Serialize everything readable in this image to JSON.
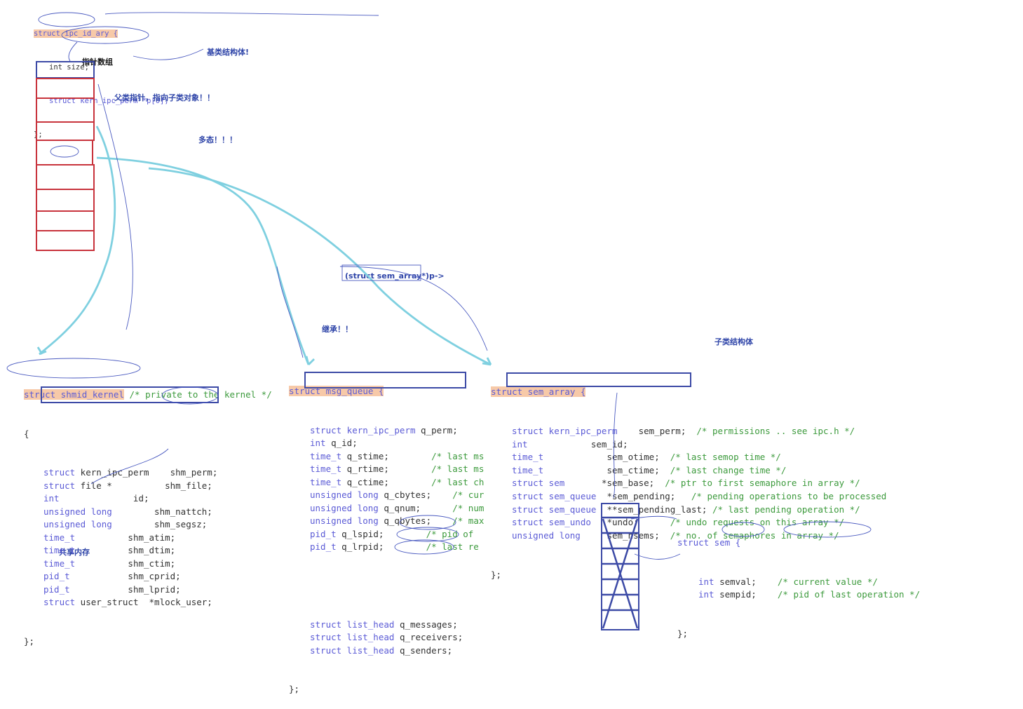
{
  "ipc_id_ary": {
    "open": "struct ipc_id_ary {",
    "l1": "int size;",
    "l2": "struct kern_ipc_perm *p[0];",
    "close": "};"
  },
  "notes": {
    "ptr_array": "指针数组",
    "base_struct": "基类结构体!",
    "parent_ptr": "父类指针，指向子类对象！！",
    "polymorph": "多态！！！",
    "cast": "(struct sem_array*)p->",
    "inherit": "继承！！",
    "child_struct": "子类结构体",
    "shared_mem": "共享内存"
  },
  "shmid_kernel": {
    "open_kw": "struct shmid_kernel",
    "open_cm": " /* private to the kernel */",
    "brace": "{",
    "lines": [
      [
        "struct",
        " kern_ipc_perm    shm_perm;"
      ],
      [
        "struct",
        " file *          shm_file;"
      ],
      [
        "int",
        "              id;"
      ],
      [
        "unsigned long",
        "        shm_nattch;"
      ],
      [
        "unsigned long",
        "        shm_segsz;"
      ],
      [
        "time_t",
        "          shm_atim;"
      ],
      [
        "time_t",
        "          shm_dtim;"
      ],
      [
        "time_t",
        "          shm_ctim;"
      ],
      [
        "pid_t",
        "           shm_cprid;"
      ],
      [
        "pid_t",
        "           shm_lprid;"
      ],
      [
        "struct",
        " user_struct  *mlock_user;"
      ]
    ],
    "close": "};"
  },
  "msg_queue": {
    "open": "struct msg_queue {",
    "lines": [
      [
        "struct kern_ipc_perm",
        " q_perm;",
        ""
      ],
      [
        "int",
        " q_id;",
        ""
      ],
      [
        "time_t",
        " q_stime;",
        "        /* last ms"
      ],
      [
        "time_t",
        " q_rtime;",
        "        /* last ms"
      ],
      [
        "time_t",
        " q_ctime;",
        "        /* last ch"
      ],
      [
        "unsigned long",
        " q_cbytes;",
        "    /* cur"
      ],
      [
        "unsigned long",
        " q_qnum;",
        "      /* num"
      ],
      [
        "unsigned long",
        " q_qbytes;",
        "    /* max"
      ],
      [
        "pid_t",
        " q_lspid;",
        "        /* pid of"
      ],
      [
        "pid_t",
        " q_lrpid;",
        "        /* last re"
      ]
    ],
    "list_lines": [
      [
        "struct",
        " list_head",
        " q_messages;"
      ],
      [
        "struct",
        " list_head",
        " q_receivers;"
      ],
      [
        "struct",
        " list_head",
        " q_senders;"
      ]
    ],
    "close": "};"
  },
  "sem_array": {
    "open": "struct sem_array {",
    "lines": [
      [
        "struct kern_ipc_perm",
        "    sem_perm;",
        "  /* permissions .. see ipc.h */"
      ],
      [
        "int",
        "            sem_id;",
        ""
      ],
      [
        "time_t",
        "            sem_otime;",
        "  /* last semop time */"
      ],
      [
        "time_t",
        "            sem_ctime;",
        "  /* last change time */"
      ],
      [
        "struct sem",
        "       *sem_base;",
        "  /* ptr to first semaphore in array */"
      ],
      [
        "struct sem_queue",
        "  *sem_pending;",
        "   /* pending operations to be processed"
      ],
      [
        "struct sem_queue",
        "  **sem_pending_last;",
        " /* last pending operation */"
      ],
      [
        "struct sem_undo",
        "   *undo;",
        "      /* undo requests on this array */"
      ],
      [
        "unsigned long",
        "     sem_nsems;",
        "  /* no. of semaphores in array */"
      ]
    ],
    "close": "};"
  },
  "sem": {
    "open": "struct sem {",
    "lines": [
      [
        "int",
        " semval;",
        "    /* current value */"
      ],
      [
        "int",
        " sempid;",
        "    /* pid of last operation */"
      ]
    ],
    "close": "};"
  },
  "colors": {
    "keyword": "#5b5bd6",
    "comment": "#3c9a3c",
    "highlight": "#f7c9a8",
    "box_blue": "#3c4aa6",
    "box_red": "#c8333c",
    "arrow_cyan": "#7fd0e0",
    "note_blue": "#2e44a8"
  }
}
